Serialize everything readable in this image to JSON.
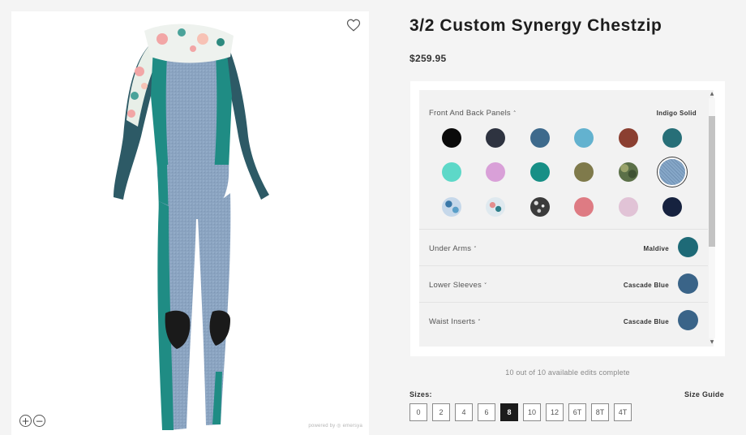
{
  "product": {
    "title": "3/2 Custom Synergy Chestzip",
    "price": "$259.95"
  },
  "viewer": {
    "powered_by": "powered by ◎ emersya",
    "zoom_in_symbol": "+",
    "zoom_out_symbol": "−"
  },
  "configurator": {
    "front_panels": {
      "label": "Front And Back Panels",
      "chevron": "˄",
      "value": "Indigo Solid",
      "swatches": [
        {
          "color": "#0a0a0a"
        },
        {
          "color": "#2e3340"
        },
        {
          "color": "#3e6a8c"
        },
        {
          "color": "#63b2cf"
        },
        {
          "color": "#8b3f31"
        },
        {
          "color": "#276f78"
        },
        {
          "color": "#5dd8c8"
        },
        {
          "color": "#d9a0d8"
        },
        {
          "color": "#178f86"
        },
        {
          "color": "#7f7a4b"
        },
        {
          "color": "#5b7048",
          "pattern": "camo"
        },
        {
          "color": "#7b9ec0",
          "pattern": "denim",
          "selected": true
        },
        {
          "color": "#c6d8ea",
          "pattern": "floral-blue"
        },
        {
          "color": "#dfe9ef",
          "pattern": "floral-pink"
        },
        {
          "color": "#3b3b3b",
          "pattern": "speckle"
        },
        {
          "color": "#de7b83"
        },
        {
          "color": "#e1c3d6"
        },
        {
          "color": "#16223f"
        }
      ]
    },
    "rows": [
      {
        "label": "Under Arms",
        "chevron": "˅",
        "value": "Maldive",
        "color": "#1e6a77"
      },
      {
        "label": "Lower Sleeves",
        "chevron": "˅",
        "value": "Cascade Blue",
        "color": "#3a6488"
      },
      {
        "label": "Waist Inserts",
        "chevron": "˅",
        "value": "Cascade Blue",
        "color": "#3a6488"
      }
    ]
  },
  "edits_status": "10 out of 10 available edits complete",
  "sizes": {
    "label": "Sizes:",
    "guide": "Size Guide",
    "options": [
      "0",
      "2",
      "4",
      "6",
      "8",
      "10",
      "12",
      "6T",
      "8T",
      "4T"
    ],
    "selected": "8"
  },
  "icons": {
    "wishlist": "heart-icon",
    "zoom_in": "zoom-in-icon",
    "zoom_out": "zoom-out-icon",
    "scroll_up": "arrow-up-icon",
    "scroll_down": "arrow-down-icon"
  }
}
